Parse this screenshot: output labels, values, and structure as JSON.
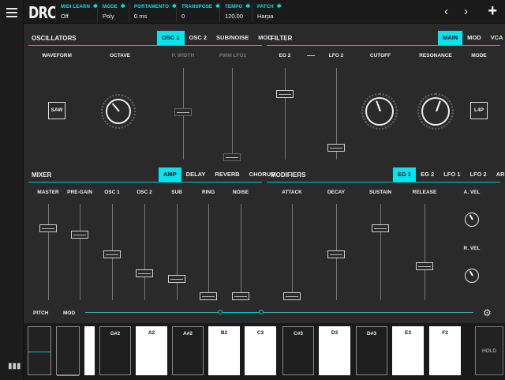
{
  "app": {
    "title": "DRC"
  },
  "header": {
    "params": [
      {
        "label": "MIDI LEARN",
        "value": "Off"
      },
      {
        "label": "MODE",
        "value": "Poly"
      },
      {
        "label": "PORTAMENTO",
        "value": "0 ms"
      },
      {
        "label": "TRANSPOSE",
        "value": "0"
      },
      {
        "label": "TEMPO",
        "value": "120.00"
      },
      {
        "label": "PATCH",
        "value": "Harpa"
      }
    ],
    "gear_glyph": "✱",
    "prev": "‹",
    "next": "›",
    "add": "+"
  },
  "oscillators": {
    "title": "OSCILLATORS",
    "tabs": [
      "OSC 1",
      "OSC 2",
      "SUB/NOISE",
      "MOD"
    ],
    "active_tab": "OSC 1",
    "labels": {
      "waveform": "WAVEFORM",
      "octave": "OCTAVE",
      "pwidth": "P. WIDTH",
      "pwm": "PWM LFO1"
    },
    "waveform_value": "SAW"
  },
  "filter": {
    "title": "FILTER",
    "tabs": [
      "MAIN",
      "MOD",
      "VCA"
    ],
    "active_tab": "MAIN",
    "labels": {
      "eg2": "EG 2",
      "lfo2": "LFO 2",
      "cutoff": "CUTOFF",
      "resonance": "RESONANCE",
      "mode": "MODE"
    },
    "mode_value": "L4P"
  },
  "mixer": {
    "title": "MIXER",
    "tabs": [
      "AMP",
      "DELAY",
      "REVERB",
      "CHORUS"
    ],
    "active_tab": "AMP",
    "channels": [
      "MASTER",
      "PRE-GAIN",
      "OSC 1",
      "OSC 2",
      "SUB",
      "RING",
      "NOISE"
    ],
    "levels": [
      0.77,
      0.7,
      0.47,
      0.26,
      0.2,
      0.0,
      0.0
    ]
  },
  "modifiers": {
    "title": "MODIFIERS",
    "tabs": [
      "EG 1",
      "EG 2",
      "LFO 1",
      "LFO 2",
      "ARP"
    ],
    "active_tab": "EG 1",
    "labels": [
      "ATTACK",
      "DECAY",
      "SUSTAIN",
      "RELEASE"
    ],
    "levels": [
      0.0,
      0.47,
      0.77,
      0.34
    ],
    "vel_labels": {
      "a": "A. VEL",
      "r": "R. VEL"
    }
  },
  "keyboard": {
    "pitch_label": "PITCH",
    "mod_label": "MOD",
    "keys": [
      {
        "label": "",
        "color": "white"
      },
      {
        "label": "G#2",
        "color": "black"
      },
      {
        "label": "A2",
        "color": "white"
      },
      {
        "label": "A#2",
        "color": "black"
      },
      {
        "label": "B2",
        "color": "white"
      },
      {
        "label": "C3",
        "color": "white"
      },
      {
        "label": "C#3",
        "color": "black"
      },
      {
        "label": "D3",
        "color": "white"
      },
      {
        "label": "D#3",
        "color": "black"
      },
      {
        "label": "E3",
        "color": "white"
      },
      {
        "label": "F3",
        "color": "white"
      }
    ],
    "hold_label": "HOLD"
  },
  "colors": {
    "accent": "#00e5ee",
    "background": "#2a2a2a",
    "bar": "#1a1a1a"
  }
}
